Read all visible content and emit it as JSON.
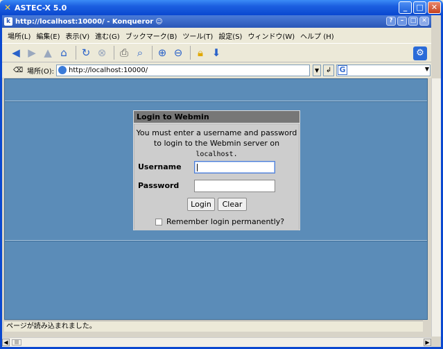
{
  "window": {
    "title": "ASTEC-X 5.0"
  },
  "browser": {
    "title": "http://localhost:10000/ - Konqueror"
  },
  "menu": [
    "場所(L)",
    "編集(E)",
    "表示(V)",
    "進む(G)",
    "ブックマーク(B)",
    "ツール(T)",
    "設定(S)",
    "ウィンドウ(W)",
    "ヘルプ (H)"
  ],
  "location": {
    "label": "場所(O):",
    "url": "http://localhost:10000/"
  },
  "login": {
    "heading": "Login to Webmin",
    "message": "You must enter a username and password to login to the Webmin server on",
    "host": "localhost.",
    "username_label": "Username",
    "password_label": "Password",
    "username_value": "",
    "password_value": "",
    "login_button": "Login",
    "clear_button": "Clear",
    "remember_label": "Remember login permanently?"
  },
  "status": "ページが読み込まれました。",
  "colors": {
    "content_bg": "#5b8cb8",
    "title_bar": "#0a48d0",
    "login_box": "#cdcdcd"
  },
  "icons": [
    "back-icon",
    "forward-icon",
    "up-icon",
    "home-icon",
    "reload-icon",
    "stop-icon",
    "print-icon",
    "find-icon",
    "zoom-in-icon",
    "zoom-out-icon",
    "lock-icon",
    "download-icon",
    "konqueror-gear-icon"
  ]
}
